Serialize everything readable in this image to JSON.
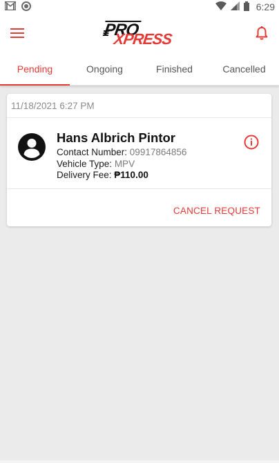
{
  "status_bar": {
    "time": "6:29",
    "left_icons": [
      "gmail-icon",
      "circle-notification-icon"
    ],
    "right_icons": [
      "wifi-icon",
      "signal-icon",
      "battery-icon"
    ]
  },
  "app_bar": {
    "menu_icon": "hamburger-menu-icon",
    "logo": {
      "part1": "PRO",
      "part2": "XPRESS"
    },
    "bell_icon": "bell-icon",
    "accent_color": "#e53935"
  },
  "tabs": [
    {
      "label": "Pending",
      "active": true
    },
    {
      "label": "Ongoing",
      "active": false
    },
    {
      "label": "Finished",
      "active": false
    },
    {
      "label": "Cancelled",
      "active": false
    }
  ],
  "request": {
    "datetime": "11/18/2021 6:27 PM",
    "customer_name": "Hans Albrich Pintor",
    "contact_label": "Contact Number: ",
    "contact_value": "09917864856",
    "vehicle_label": "Vehicle Type: ",
    "vehicle_value": "MPV",
    "fee_label": "Delivery Fee: ",
    "fee_value": "₱110.00",
    "cancel_label": "CANCEL REQUEST"
  }
}
